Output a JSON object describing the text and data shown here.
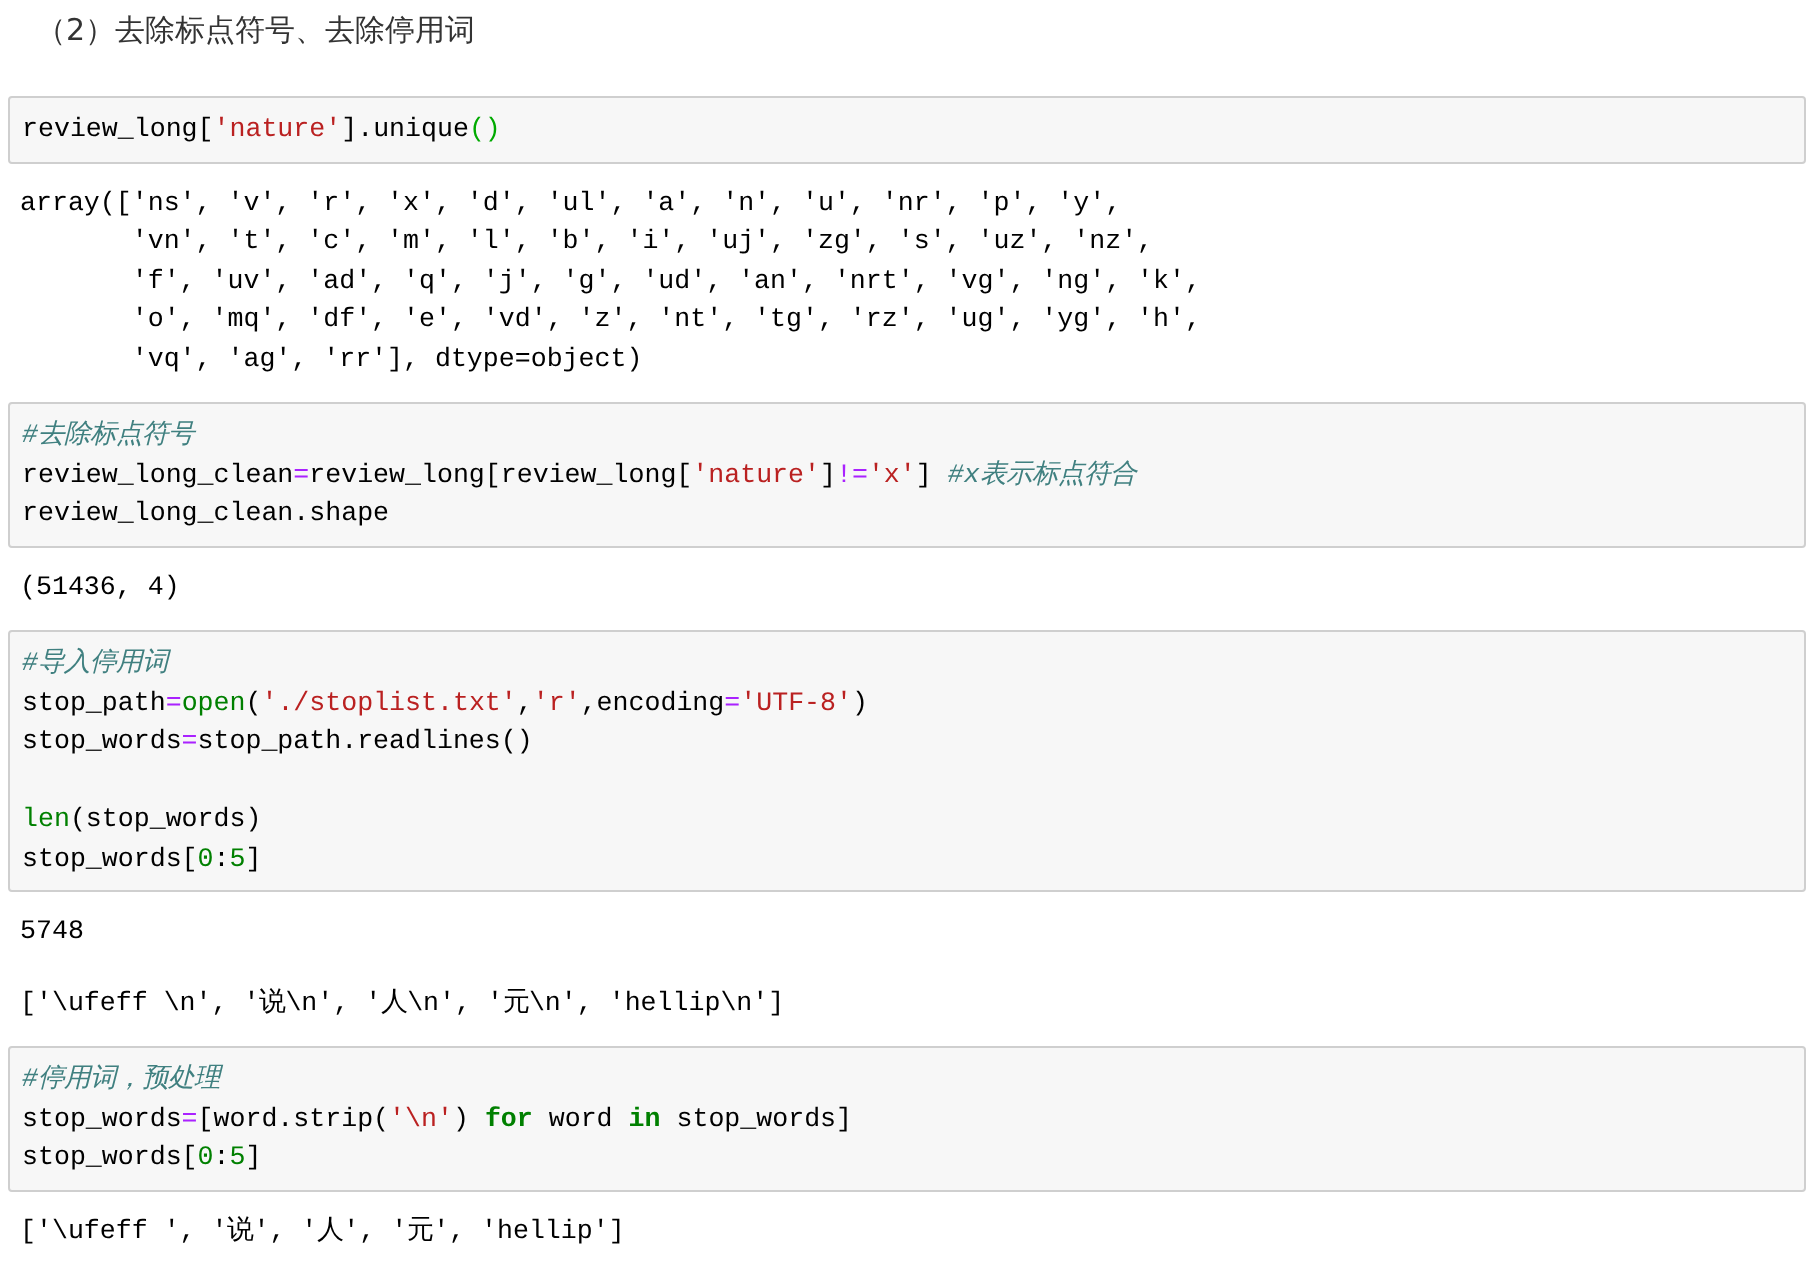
{
  "heading": "（2）去除标点符号、去除停用词",
  "cells": [
    {
      "kind": "input",
      "lines": [
        {
          "kind": "code",
          "tokens": [
            {
              "kind": "plain",
              "text": "review_long["
            },
            {
              "kind": "string",
              "text": "'nature'"
            },
            {
              "kind": "plain",
              "text": "].unique"
            },
            {
              "kind": "match",
              "text": "()"
            }
          ]
        }
      ]
    },
    {
      "kind": "output",
      "lines": [
        "array(['ns', 'v', 'r', 'x', 'd', 'ul', 'a', 'n', 'u', 'nr', 'p', 'y',",
        "       'vn', 't', 'c', 'm', 'l', 'b', 'i', 'uj', 'zg', 's', 'uz', 'nz',",
        "       'f', 'uv', 'ad', 'q', 'j', 'g', 'ud', 'an', 'nrt', 'vg', 'ng', 'k',",
        "       'o', 'mq', 'df', 'e', 'vd', 'z', 'nt', 'tg', 'rz', 'ug', 'yg', 'h',",
        "       'vq', 'ag', 'rr'], dtype=object)"
      ]
    },
    {
      "kind": "input",
      "lines": [
        {
          "kind": "code",
          "tokens": [
            {
              "kind": "comment",
              "text": "#去除标点符号"
            }
          ]
        },
        {
          "kind": "code",
          "tokens": [
            {
              "kind": "plain",
              "text": "review_long_clean"
            },
            {
              "kind": "operator",
              "text": "="
            },
            {
              "kind": "plain",
              "text": "review_long[review_long["
            },
            {
              "kind": "string",
              "text": "'nature'"
            },
            {
              "kind": "plain",
              "text": "]"
            },
            {
              "kind": "operator",
              "text": "!="
            },
            {
              "kind": "string",
              "text": "'x'"
            },
            {
              "kind": "plain",
              "text": "] "
            },
            {
              "kind": "comment",
              "text": "#x表示标点符合"
            }
          ]
        },
        {
          "kind": "code",
          "tokens": [
            {
              "kind": "plain",
              "text": "review_long_clean.shape"
            }
          ]
        }
      ]
    },
    {
      "kind": "output",
      "lines": [
        "(51436, 4)"
      ]
    },
    {
      "kind": "input",
      "lines": [
        {
          "kind": "code",
          "tokens": [
            {
              "kind": "comment",
              "text": "#导入停用词"
            }
          ]
        },
        {
          "kind": "code",
          "tokens": [
            {
              "kind": "plain",
              "text": "stop_path"
            },
            {
              "kind": "operator",
              "text": "="
            },
            {
              "kind": "builtin",
              "text": "open"
            },
            {
              "kind": "plain",
              "text": "("
            },
            {
              "kind": "string",
              "text": "'./stoplist.txt'"
            },
            {
              "kind": "plain",
              "text": ","
            },
            {
              "kind": "string",
              "text": "'r'"
            },
            {
              "kind": "plain",
              "text": ",encoding"
            },
            {
              "kind": "operator",
              "text": "="
            },
            {
              "kind": "string",
              "text": "'UTF-8'"
            },
            {
              "kind": "plain",
              "text": ")"
            }
          ]
        },
        {
          "kind": "code",
          "tokens": [
            {
              "kind": "plain",
              "text": "stop_words"
            },
            {
              "kind": "operator",
              "text": "="
            },
            {
              "kind": "plain",
              "text": "stop_path.readlines()"
            }
          ]
        },
        {
          "kind": "blank"
        },
        {
          "kind": "code",
          "tokens": [
            {
              "kind": "builtin",
              "text": "len"
            },
            {
              "kind": "plain",
              "text": "(stop_words)"
            }
          ]
        },
        {
          "kind": "code",
          "tokens": [
            {
              "kind": "plain",
              "text": "stop_words["
            },
            {
              "kind": "number",
              "text": "0"
            },
            {
              "kind": "plain",
              "text": ":"
            },
            {
              "kind": "number",
              "text": "5"
            },
            {
              "kind": "plain",
              "text": "]"
            }
          ]
        }
      ]
    },
    {
      "kind": "output",
      "lines": [
        "5748"
      ]
    },
    {
      "kind": "output",
      "lines": [
        "['\\ufeff \\n', '说\\n', '人\\n', '元\\n', 'hellip\\n']"
      ]
    },
    {
      "kind": "input",
      "lines": [
        {
          "kind": "code",
          "tokens": [
            {
              "kind": "comment",
              "text": "#停用词，预处理"
            }
          ]
        },
        {
          "kind": "code",
          "tokens": [
            {
              "kind": "plain",
              "text": "stop_words"
            },
            {
              "kind": "operator",
              "text": "="
            },
            {
              "kind": "plain",
              "text": "[word.strip("
            },
            {
              "kind": "string",
              "text": "'\\n'"
            },
            {
              "kind": "plain",
              "text": ") "
            },
            {
              "kind": "keyword",
              "text": "for"
            },
            {
              "kind": "plain",
              "text": " word "
            },
            {
              "kind": "keyword",
              "text": "in"
            },
            {
              "kind": "plain",
              "text": " stop_words]"
            }
          ]
        },
        {
          "kind": "code",
          "tokens": [
            {
              "kind": "plain",
              "text": "stop_words["
            },
            {
              "kind": "number",
              "text": "0"
            },
            {
              "kind": "plain",
              "text": ":"
            },
            {
              "kind": "number",
              "text": "5"
            },
            {
              "kind": "plain",
              "text": "]"
            }
          ]
        }
      ]
    },
    {
      "kind": "output",
      "lines": [
        "['\\ufeff ', '说', '人', '元', 'hellip']"
      ]
    }
  ]
}
